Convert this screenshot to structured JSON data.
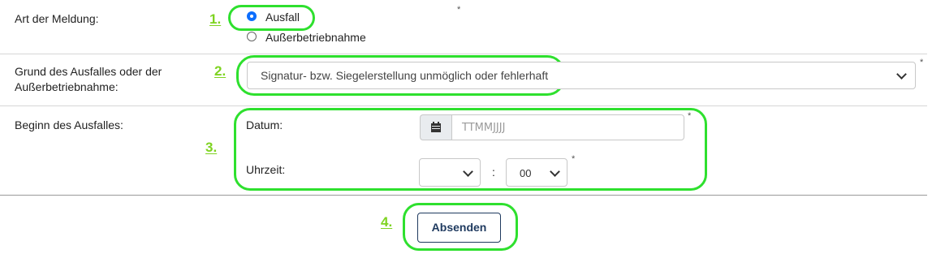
{
  "steps": [
    "1.",
    "2.",
    "3.",
    "4."
  ],
  "required_marker": "*",
  "art_der_meldung": {
    "label": "Art der Meldung:",
    "options": [
      {
        "label": "Ausfall",
        "selected": true
      },
      {
        "label": "Außerbetriebnahme",
        "selected": false
      }
    ]
  },
  "grund": {
    "label_line1": "Grund des Ausfalles oder der",
    "label_line2": "Außerbetriebnahme:",
    "selected_value": "Signatur- bzw. Siegelerstellung unmöglich oder fehlerhaft"
  },
  "beginn": {
    "label": "Beginn des Ausfalles:",
    "datum_label": "Datum:",
    "datum_placeholder": "TTMMJJJJ",
    "uhrzeit_label": "Uhrzeit:",
    "hour_value": "",
    "time_separator": ":",
    "minute_value": "00"
  },
  "submit_label": "Absenden",
  "colors": {
    "highlight": "#2ee02e",
    "step_number": "#7ed321",
    "radio_selected": "#0d6efd",
    "button_text": "#1f3a5f"
  }
}
